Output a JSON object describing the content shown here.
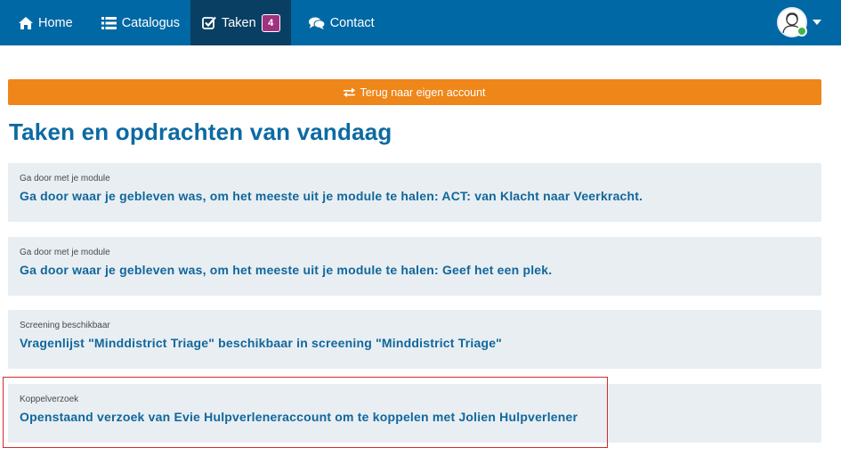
{
  "nav": {
    "items": [
      {
        "label": "Home",
        "icon": "home-icon"
      },
      {
        "label": "Catalogus",
        "icon": "list-icon"
      },
      {
        "label": "Taken",
        "icon": "checkbox-icon",
        "badge": "4",
        "active": true
      },
      {
        "label": "Contact",
        "icon": "chat-icon"
      }
    ]
  },
  "back_button": {
    "label": "Terug naar eigen account",
    "icon": "exchange-icon"
  },
  "page_title": "Taken en opdrachten van vandaag",
  "tasks": [
    {
      "category": "Ga door met je module",
      "text": "Ga door waar je gebleven was, om het meeste uit je module te halen: ACT: van Klacht naar Veerkracht."
    },
    {
      "category": "Ga door met je module",
      "text": "Ga door waar je gebleven was, om het meeste uit je module te halen: Geef het een plek."
    },
    {
      "category": "Screening beschikbaar",
      "text": "Vragenlijst \"Minddistrict Triage\" beschikbaar in screening \"Minddistrict Triage\""
    },
    {
      "category": "Koppelverzoek",
      "text": "Openstaand verzoek van Evie Hulpverleneraccount om te koppelen met Jolien Hulpverlener"
    }
  ],
  "colors": {
    "navbar": "#0068a4",
    "nav_active": "#0a3f64",
    "badge": "#a0327f",
    "back_button": "#ee8619",
    "title": "#0c6aa3",
    "card_bg": "#e8eef2",
    "highlight": "#d22b2b"
  }
}
